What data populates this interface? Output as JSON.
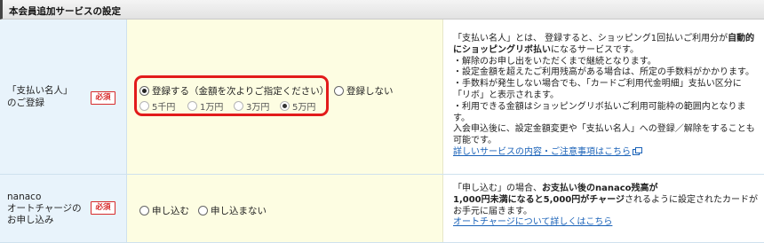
{
  "section": {
    "title": "本会員追加サービスの設定"
  },
  "rows": {
    "shiharai": {
      "label_line1": "「支払い名人」",
      "label_line2": "のご登録",
      "badge": "必須",
      "options": {
        "register": "登録する（金額を次よりご指定ください）",
        "no_register": "登録しない"
      },
      "amounts": [
        "5千円",
        "1万円",
        "3万円",
        "5万円"
      ],
      "selected_amount": "5万円",
      "desc": {
        "l1a": "「支払い名人」とは、 登録すると、ショッピング1回払いご利用分が",
        "l1b": "自動的",
        "l2a": "にショッピングリボ払い",
        "l2b": "になるサービスです。",
        "l3": "・解除のお申し出をいただくまで継続となります。",
        "l4": "・設定金額を超えたご利用残高がある場合は、所定の手数料がかかります。",
        "l5": "・手数料が発生しない場合でも、「カードご利用代金明細」支払い区分に",
        "l6": "「リボ」と表示されます。",
        "l7": "・利用できる金額はショッピングリボ払いご利用可能枠の範囲内となりま",
        "l8": "す。",
        "l9": "入会申込後に、設定金額変更や「支払い名人」への登録／解除をすることも",
        "l10": "可能です。",
        "link": "詳しいサービスの内容・ご注意事項はこちら"
      }
    },
    "nanaco": {
      "label_line1": "nanaco",
      "label_line2": "オートチャージの",
      "label_line3": "お申し込み",
      "badge": "必須",
      "options": {
        "apply": "申し込む",
        "no_apply": "申し込まない"
      },
      "desc": {
        "l1a": "「申し込む」の場合、",
        "l1b": "お支払い後のnanaco残高が",
        "l2a": "1,000円未満になると5,000円がチャージ",
        "l2b": "されるように設定されたカードが",
        "l3": "お手元に届きます。",
        "link": "オートチャージについて詳しくはこちら"
      }
    }
  },
  "colors": {
    "accent_red": "#e21b1b",
    "link_blue": "#1a62b8",
    "label_bg": "#e8f3fb",
    "input_bg": "#fdfde2"
  }
}
